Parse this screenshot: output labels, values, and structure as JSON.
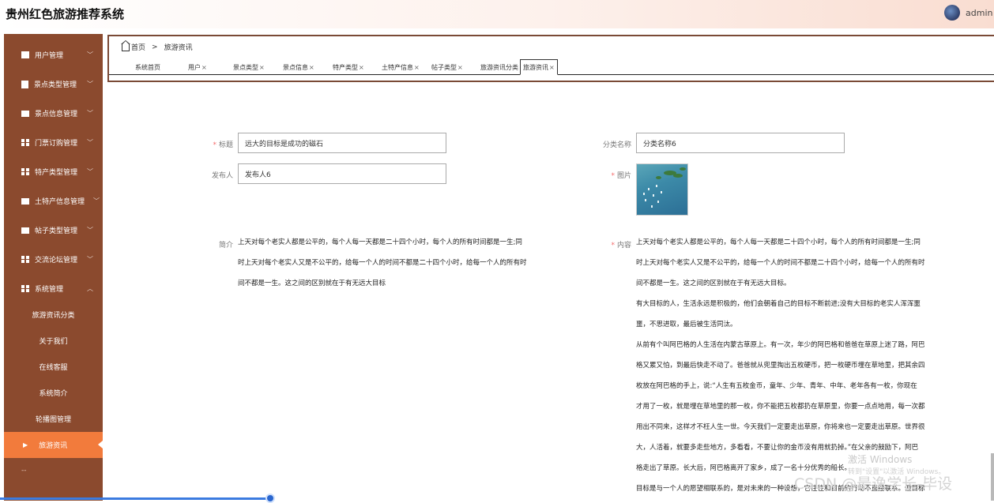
{
  "app": {
    "title": "贵州红色旅游推荐系统",
    "user": "admin"
  },
  "sidebar": {
    "items": [
      {
        "label": "用户管理",
        "icon": "table-icon"
      },
      {
        "label": "景点类型管理",
        "icon": "clipboard-icon"
      },
      {
        "label": "景点信息管理",
        "icon": "monitor-icon"
      },
      {
        "label": "门票订购管理",
        "icon": "grid-icon"
      },
      {
        "label": "特产类型管理",
        "icon": "grid-icon"
      },
      {
        "label": "土特产信息管理",
        "icon": "printer-icon"
      },
      {
        "label": "帖子类型管理",
        "icon": "chat-icon"
      },
      {
        "label": "交流论坛管理",
        "icon": "grid-icon"
      },
      {
        "label": "系统管理",
        "icon": "grid-icon"
      }
    ],
    "sub_items": [
      {
        "label": "旅游资讯分类"
      },
      {
        "label": "关于我们"
      },
      {
        "label": "在线客服"
      },
      {
        "label": "系统简介"
      },
      {
        "label": "轮播图管理"
      },
      {
        "label": "旅游资讯"
      }
    ],
    "more": "--"
  },
  "breadcrumb": {
    "home": "首页",
    "sep": ">",
    "current": "旅游资讯"
  },
  "tabs": [
    {
      "label": "系统首页",
      "closable": ""
    },
    {
      "label": "用户",
      "closable": "×"
    },
    {
      "label": "景点类型",
      "closable": "×"
    },
    {
      "label": "景点信息",
      "closable": "×"
    },
    {
      "label": "特产类型",
      "closable": "×"
    },
    {
      "label": "土特产信息",
      "closable": "×"
    },
    {
      "label": "帖子类型",
      "closable": "×"
    },
    {
      "label": "旅游资讯分类",
      "closable": "×"
    },
    {
      "label": "旅游资讯",
      "closable": "×"
    }
  ],
  "form": {
    "title_label": "标题",
    "title_value": "远大的目标是成功的磁石",
    "category_label": "分类名称",
    "category_value": "分类名称6",
    "publisher_label": "发布人",
    "publisher_value": "发布人6",
    "image_label": "图片",
    "summary_label": "简介",
    "summary_lines": [
      "上天对每个老实人都是公平的，每个人每一天都是二十四个小时，每个人的所有时间都是一生;同",
      "时上天对每个老实人又是不公平的，给每一个人的时间不都是二十四个小时，给每一个人的所有时",
      "间不都是一生。这之间的区别就在于有无远大目标"
    ],
    "content_label": "内容",
    "content_lines": [
      "上天对每个老实人都是公平的，每个人每一天都是二十四个小时，每个人的所有时间都是一生;同",
      "时上天对每个老实人又是不公平的，给每一个人的时间不都是二十四个小时，给每一个人的所有时",
      "间不都是一生。这之间的区别就在于有无远大目标。",
      "有大目标的人，生活永远是积极的，他们会朝着自己的目标不断前进;没有大目标的老实人浑浑噩",
      "噩，不思进取，最后被生活同汰。",
      "从前有个叫阿巴格的人生活在内蒙古草原上。有一次，年少的阿巴格和爸爸在草原上迷了路，阿巴",
      "格又累又怕，到最后快走不动了。爸爸就从兜里掏出五枚硬币，把一枚硬币埋在草地里，把其余四",
      "枚放在阿巴格的手上，说:“人生有五枚金币，童年、少年、青年、中年、老年各有一枚，你现在",
      "才用了一枚，就是埋在草地里的那一枚，你不能把五枚都扔在草原里，你要一点点地用，每一次都",
      "用出不同来，这样才不枉人生一世。今天我们一定要走出草原，你将来也一定要走出草原。世界很",
      "大，人活着，就要多走些地方，多看看，不要让你的金币没有用就扔掉。”在父亲的鼓励下，阿巴",
      "格走出了草原。长大后，阿巴格离开了家乡，成了一名十分优秀的船长。",
      "目标是与一个人的愿望相联系的，是对未来的一种设想，它往往和目前的行动不直接联系。但目标"
    ]
  },
  "watermark": {
    "activate": "激活 Windows",
    "activate_hint": "转到\"设置\"以激活 Windows。",
    "csdn": "CSDN @最逸学长-毕设"
  },
  "colors": {
    "sidebar_bg": "#8b4a2e",
    "active_item": "#f27b3c",
    "content_border": "#7a4a36"
  }
}
